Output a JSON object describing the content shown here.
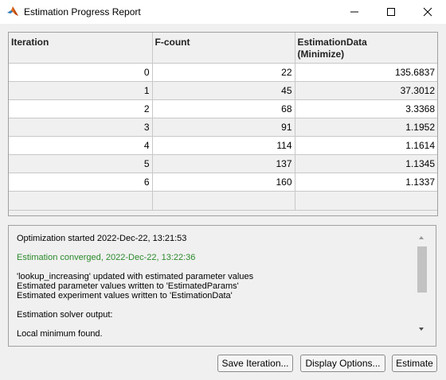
{
  "window": {
    "title": "Estimation Progress Report"
  },
  "table": {
    "headers": [
      "Iteration",
      "F-count",
      "EstimationData\n(Minimize)"
    ],
    "header_line1": [
      "Iteration",
      "F-count",
      "EstimationData"
    ],
    "header_line2": [
      "",
      "",
      "(Minimize)"
    ],
    "rows": [
      [
        "0",
        "22",
        "135.6837"
      ],
      [
        "1",
        "45",
        "37.3012"
      ],
      [
        "2",
        "68",
        "3.3368"
      ],
      [
        "3",
        "91",
        "1.1952"
      ],
      [
        "4",
        "114",
        "1.1614"
      ],
      [
        "5",
        "137",
        "1.1345"
      ],
      [
        "6",
        "160",
        "1.1337"
      ]
    ]
  },
  "log": {
    "started": "Optimization started 2022-Dec-22, 13:21:53",
    "converged": "Estimation converged, 2022-Dec-22, 13:22:36",
    "updated": "'lookup_increasing' updated with estimated parameter values",
    "params_written": "Estimated parameter values written to 'EstimatedParams'",
    "experiment_written": "Estimated experiment values written to 'EstimationData'",
    "solver_output": "Estimation solver output:",
    "local_min": "Local minimum found."
  },
  "buttons": {
    "save_iteration": "Save Iteration...",
    "display_options": "Display Options...",
    "estimate": "Estimate"
  },
  "colors": {
    "converged_text": "#2b8a2b"
  }
}
